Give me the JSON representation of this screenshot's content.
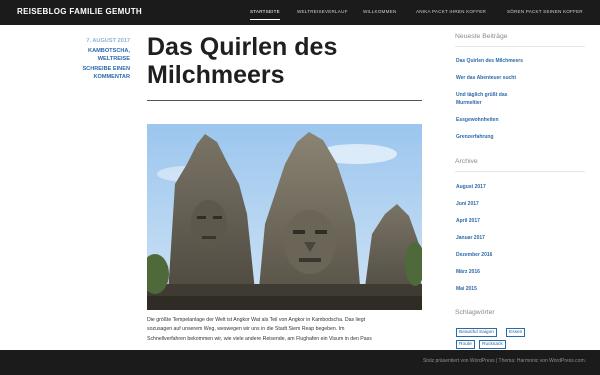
{
  "header": {
    "site_title": "REISEBLOG FAMILIE GEMUTH",
    "nav": [
      "STARTSEITE",
      "WELTREISEVERLAUF",
      "WILLKOMMEN",
      "ANIKA PACKT IHREN KOFFER",
      "SÖREN PACKT SEINEN KOFFER"
    ]
  },
  "post": {
    "date": "7. AUGUST 2017",
    "categories": "KAMBOTSCHA, WELTREISE",
    "categories_line1": "KAMBOTSCHA,",
    "categories_line2": "WELTREISE",
    "comment_link_line1": "SCHREIBE EINEN",
    "comment_link_line2": "KOMMENTAR",
    "title_line1": "Das Quirlen des",
    "title_line2": "Milchmeers",
    "image_description": "Steinerne Gesichtstürme eines Tempels",
    "body_line1": "Die größte Tempelanlage der Welt ist Angkor Wat als Teil von Angkor in Kambodscha. Das liegt",
    "body_line2": "sozusagen auf unserem Weg, weswegen wir uns in die Stadt Siem Reap begeben. Im",
    "body_line3": "Schnellverfahren bekommen wir, wie viele andere Reisende, am Flughafen ein Visum in den Pass"
  },
  "sidebar": {
    "recent_heading": "Neueste Beiträge",
    "recent_posts": [
      "Das Quirlen des Milchmeers",
      "Wer das Abenteuer sucht",
      "Und täglich grüßt das Murmeltier",
      "Essgewohnheiten",
      "Grenzerfahrung"
    ],
    "archive_heading": "Archive",
    "archives": [
      "August 2017",
      "Juni 2017",
      "April 2017",
      "Januar 2017",
      "Dezember 2016",
      "März 2016",
      "Mai 2015"
    ],
    "tags_heading": "Schlagwörter",
    "tags": [
      "Beautiful Saigon",
      "Essen",
      "Route",
      "Rucksack"
    ]
  },
  "footer": {
    "credit": "Stolz präsentiert von WordPress | Thema: Harmonic von WordPress.com."
  },
  "colors": {
    "topbar": "#1b1b1b",
    "link": "#2b6aa8",
    "footer": "#1b1b1b"
  }
}
